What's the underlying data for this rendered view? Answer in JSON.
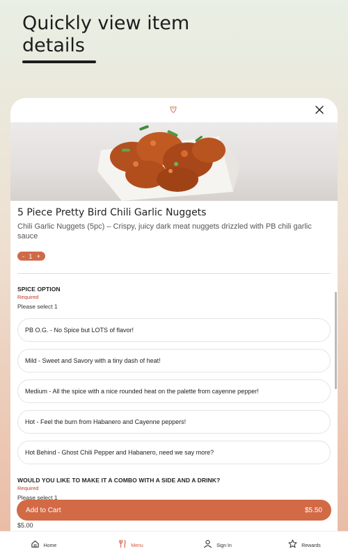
{
  "headline": {
    "line1": "Quickly view item",
    "line2": "details"
  },
  "item": {
    "title": "5 Piece Pretty Bird Chili Garlic Nuggets",
    "description": "Chili Garlic Nuggets (5pc) – Crispy, juicy dark meat nuggets drizzled with PB chili garlic sauce",
    "quantity": {
      "minus": "-",
      "value": "1",
      "plus": "+"
    }
  },
  "spice_group": {
    "title": "SPICE OPTION",
    "required": "Required",
    "hint": "Please select 1",
    "options": [
      "PB O.G. - No Spice but LOTS of flavor!",
      "Mild - Sweet and Savory with a tiny dash of heat!",
      "Medium - All the spice with a nice rounded heat on the palette from cayenne pepper!",
      "Hot - Feel the burn from Habanero and Cayenne peppers!",
      "Hot Behind - Ghost Chili Pepper and Habanero, need we say more?"
    ]
  },
  "combo_group": {
    "title": "WOULD YOU LIKE TO MAKE IT A COMBO WITH A SIDE AND A DRINK?",
    "required": "Required",
    "hint": "Please select 1",
    "price": "$5.00"
  },
  "cart": {
    "label": "Add to Cart",
    "price": "$5.50"
  },
  "tabs": [
    {
      "label": "Home",
      "icon": "home-icon"
    },
    {
      "label": "Menu",
      "icon": "fork-knife-icon"
    },
    {
      "label": "Sign In",
      "icon": "user-icon"
    },
    {
      "label": "Rewards",
      "icon": "star-icon"
    }
  ],
  "colors": {
    "accent": "#d26a45",
    "required": "#c0392b",
    "active_tab": "#d35a3e"
  }
}
